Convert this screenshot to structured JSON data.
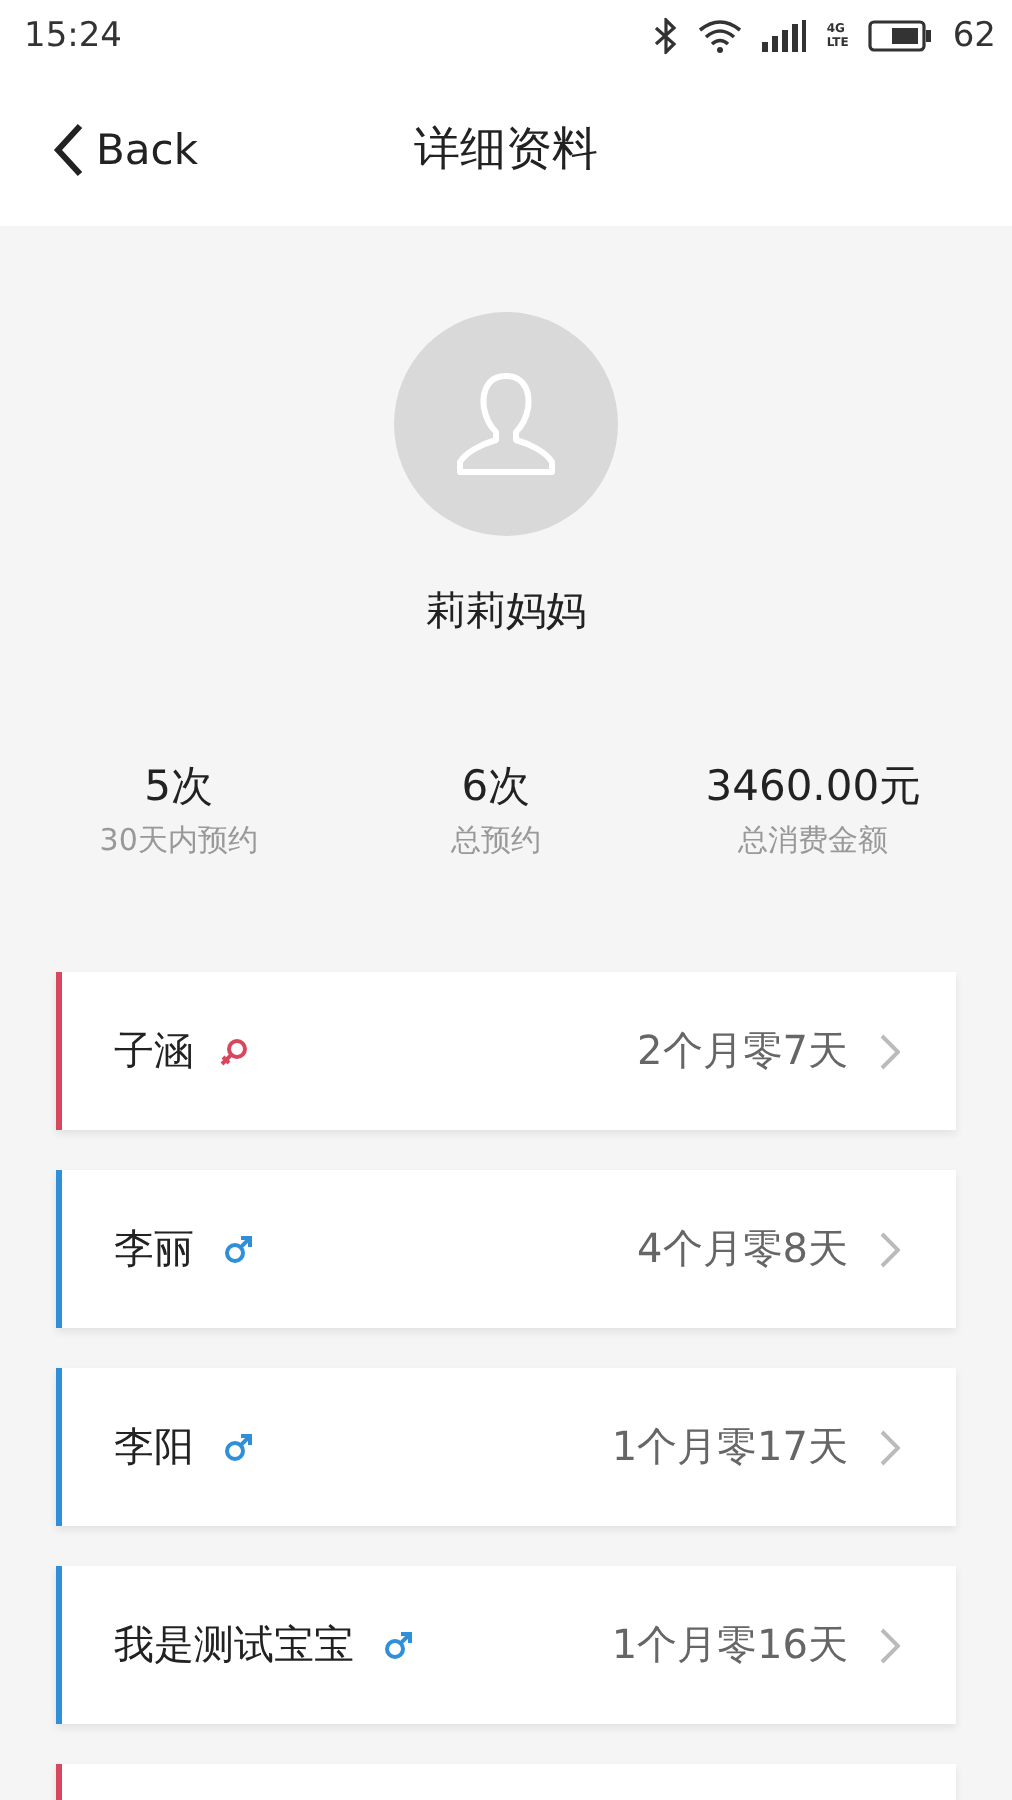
{
  "status_bar": {
    "time": "15:24",
    "network": "4G",
    "network_sub": "LTE",
    "battery": "62"
  },
  "header": {
    "back": "Back",
    "title": "详细资料"
  },
  "profile": {
    "name": "莉莉妈妈"
  },
  "stats": [
    {
      "value": "5次",
      "label": "30天内预约"
    },
    {
      "value": "6次",
      "label": "总预约"
    },
    {
      "value": "3460.00元",
      "label": "总消费金额"
    }
  ],
  "children": [
    {
      "name": "子涵",
      "kind": "female",
      "age": "2个月零7天"
    },
    {
      "name": "李丽",
      "kind": "male",
      "age": "4个月零8天"
    },
    {
      "name": "李阳",
      "kind": "male",
      "age": "1个月零17天"
    },
    {
      "name": "我是测试宝宝",
      "kind": "male",
      "age": "1个月零16天"
    },
    {
      "kind": "female"
    }
  ]
}
